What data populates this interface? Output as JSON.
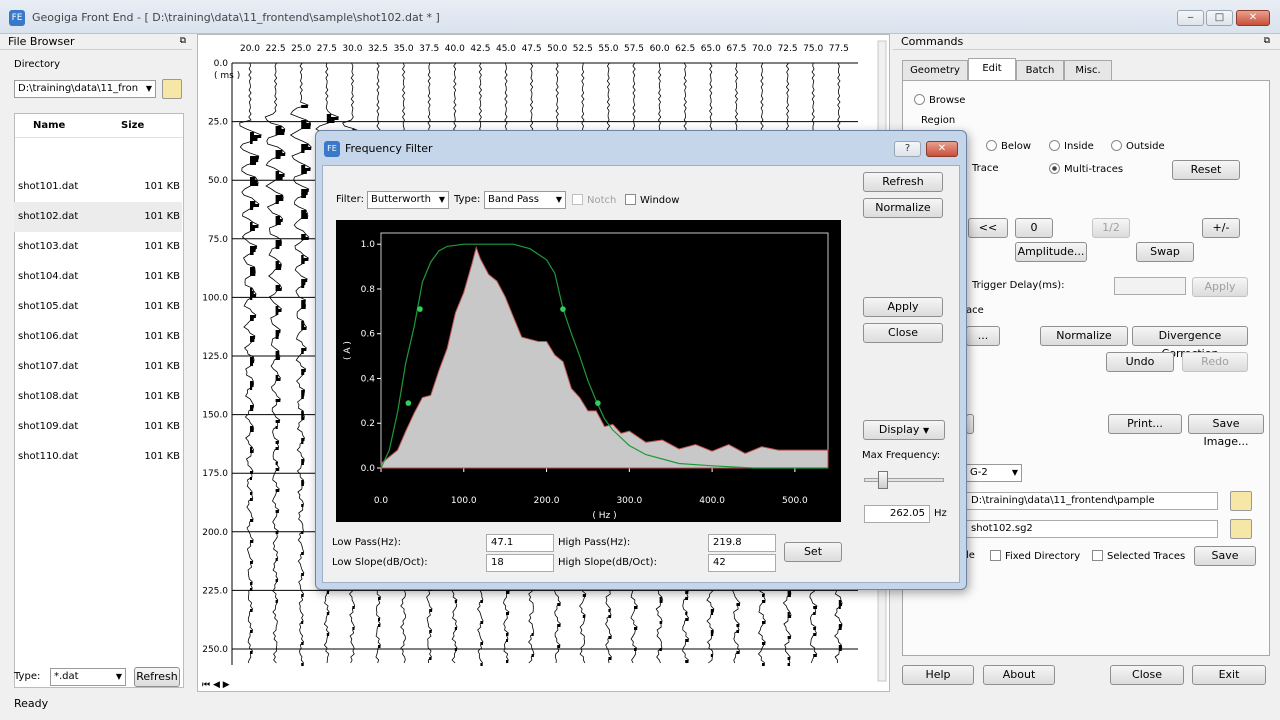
{
  "window": {
    "title": "Geogiga Front End - [ D:\\training\\data\\11_frontend\\sample\\shot102.dat * ]",
    "min": "‒",
    "max": "□",
    "close": "✕",
    "icon": "FE"
  },
  "filebrowser": {
    "title": "File Browser",
    "dir_label": "Directory",
    "dir_value": "D:\\training\\data\\11_fron",
    "col_name": "Name",
    "col_size": "Size",
    "files": [
      {
        "name": "shot101.dat",
        "size": "101 KB"
      },
      {
        "name": "shot102.dat",
        "size": "101 KB"
      },
      {
        "name": "shot103.dat",
        "size": "101 KB"
      },
      {
        "name": "shot104.dat",
        "size": "101 KB"
      },
      {
        "name": "shot105.dat",
        "size": "101 KB"
      },
      {
        "name": "shot106.dat",
        "size": "101 KB"
      },
      {
        "name": "shot107.dat",
        "size": "101 KB"
      },
      {
        "name": "shot108.dat",
        "size": "101 KB"
      },
      {
        "name": "shot109.dat",
        "size": "101 KB"
      },
      {
        "name": "shot110.dat",
        "size": "101 KB"
      }
    ],
    "type_label": "Type:",
    "type_value": "*.dat",
    "refresh": "Refresh",
    "status": "Ready"
  },
  "seismic": {
    "x_ticks": [
      "20.0",
      "22.5",
      "25.0",
      "27.5",
      "30.0",
      "32.5",
      "35.0",
      "37.5",
      "40.0",
      "42.5",
      "45.0",
      "47.5",
      "50.0",
      "52.5",
      "55.0",
      "57.5",
      "60.0",
      "62.5",
      "65.0",
      "67.5",
      "70.0",
      "72.5",
      "75.0",
      "77.5"
    ],
    "y_ticks": [
      "0.0",
      "25.0",
      "50.0",
      "75.0",
      "100.0",
      "125.0",
      "150.0",
      "175.0",
      "200.0",
      "225.0",
      "250.0"
    ],
    "y_unit": "( ms )"
  },
  "commands": {
    "title": "Commands",
    "tabs": [
      "Geometry",
      "Edit",
      "Batch",
      "Misc."
    ],
    "browse": "Browse",
    "region": "Region",
    "r_below": "Below",
    "r_inside": "Inside",
    "r_outside": "Outside",
    "trace": "Trace",
    "multitraces": "Multi-traces",
    "reset": "Reset",
    "b_left": "<<",
    "b_zero": "0",
    "b_half": "1/2",
    "b_pm": "+/-",
    "amplitude": "Amplitude...",
    "swap": "Swap",
    "trigger": "Trigger Delay(ms):",
    "apply": "Apply",
    "ace": "ace",
    "ellipsis": "...",
    "normalize": "Normalize",
    "divergence": "Divergence Correction",
    "undo": "Undo",
    "redo": "Redo",
    "print": "Print...",
    "save_image": "Save Image...",
    "sg_combo": "G-2",
    "out_dir": "D:\\training\\data\\11_frontend\\pample",
    "out_file": "shot102.sg2",
    "le": "le",
    "fixed_dir": "Fixed Directory",
    "selected_traces": "Selected Traces",
    "save": "Save",
    "help": "Help",
    "about": "About",
    "close": "Close",
    "exit": "Exit"
  },
  "dialog": {
    "title": "Frequency Filter",
    "help": "?",
    "close": "✕",
    "filter_label": "Filter:",
    "filter_value": "Butterworth",
    "type_label": "Type:",
    "type_value": "Band Pass",
    "notch": "Notch",
    "window": "Window",
    "refresh": "Refresh",
    "normalize": "Normalize",
    "apply": "Apply",
    "close_btn": "Close",
    "display": "Display",
    "max_freq_label": "Max Frequency:",
    "max_freq_value": "262.05",
    "hz": "Hz",
    "low_pass_label": "Low Pass(Hz):",
    "low_pass": "47.1",
    "high_pass_label": "High Pass(Hz):",
    "high_pass": "219.8",
    "low_slope_label": "Low Slope(dB/Oct):",
    "low_slope": "18",
    "high_slope_label": "High Slope(dB/Oct):",
    "high_slope": "42",
    "set": "Set"
  },
  "chart_data": {
    "type": "area",
    "xlabel": "( Hz )",
    "ylabel": "( A )",
    "xlim": [
      0,
      540
    ],
    "ylim": [
      0,
      1.05
    ],
    "x_ticks": [
      0,
      100,
      200,
      300,
      400,
      500
    ],
    "y_ticks": [
      0,
      0.2,
      0.4,
      0.6,
      0.8,
      1.0
    ],
    "series": [
      {
        "name": "",
        "x": [
          0,
          10,
          20,
          30,
          40,
          50,
          60,
          70,
          80,
          90,
          100,
          110,
          115,
          120,
          130,
          140,
          150,
          160,
          170,
          180,
          190,
          200,
          210,
          220,
          230,
          240,
          250,
          260,
          270,
          280,
          290,
          300,
          320,
          340,
          360,
          380,
          400,
          420,
          440,
          460,
          480,
          500,
          520,
          540
        ],
        "values": [
          0.02,
          0.05,
          0.08,
          0.15,
          0.26,
          0.3,
          0.34,
          0.42,
          0.55,
          0.68,
          0.8,
          0.9,
          1.0,
          0.92,
          0.88,
          0.82,
          0.78,
          0.66,
          0.6,
          0.56,
          0.58,
          0.55,
          0.52,
          0.46,
          0.37,
          0.3,
          0.27,
          0.24,
          0.2,
          0.18,
          0.17,
          0.15,
          0.13,
          0.11,
          0.1,
          0.09,
          0.09,
          0.09,
          0.08,
          0.08,
          0.08,
          0.08,
          0.08,
          0.08
        ]
      },
      {
        "name": "",
        "x": [
          0,
          10,
          20,
          30,
          40,
          50,
          60,
          70,
          80,
          100,
          120,
          140,
          160,
          180,
          200,
          210,
          220,
          230,
          240,
          250,
          260,
          270,
          280,
          300,
          320,
          340,
          360,
          400,
          450,
          540
        ],
        "values": [
          0,
          0.08,
          0.25,
          0.47,
          0.63,
          0.83,
          0.92,
          0.97,
          0.99,
          1.0,
          1.0,
          1.0,
          1.0,
          0.98,
          0.93,
          0.87,
          0.71,
          0.6,
          0.5,
          0.39,
          0.3,
          0.22,
          0.17,
          0.1,
          0.06,
          0.04,
          0.02,
          0.01,
          0,
          0
        ]
      }
    ],
    "control_points": [
      {
        "x": 33,
        "y": 0.29
      },
      {
        "x": 47.1,
        "y": 0.71
      },
      {
        "x": 219.8,
        "y": 0.71
      },
      {
        "x": 262,
        "y": 0.29
      }
    ]
  }
}
